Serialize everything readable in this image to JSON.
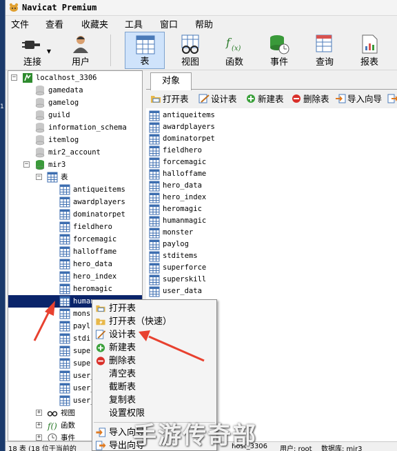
{
  "window": {
    "title": "Navicat Premium"
  },
  "menu": [
    "文件",
    "查看",
    "收藏夹",
    "工具",
    "窗口",
    "帮助"
  ],
  "toolbar": [
    {
      "label": "连接",
      "icon": "plug-icon"
    },
    {
      "label": "用户",
      "icon": "user-icon"
    },
    {
      "label": "表",
      "icon": "table-icon",
      "active": true
    },
    {
      "label": "视图",
      "icon": "view-icon"
    },
    {
      "label": "函数",
      "icon": "function-icon"
    },
    {
      "label": "事件",
      "icon": "event-icon"
    },
    {
      "label": "查询",
      "icon": "query-icon"
    },
    {
      "label": "报表",
      "icon": "report-icon"
    }
  ],
  "tree": {
    "connection": "localhost_3306",
    "databases": [
      "gamedata",
      "gamelog",
      "guild",
      "information_schema",
      "itemlog",
      "mir2_account",
      "mir3"
    ],
    "tables_folder": "表",
    "tables": [
      "antiqueitems",
      "awardplayers",
      "dominatorpet",
      "fieldhero",
      "forcemagic",
      "halloffame",
      "hero_data",
      "hero_index",
      "heromagic",
      "humanmagic",
      "monster",
      "paylog",
      "stditems",
      "superforce",
      "superskill",
      "user_data",
      "user_",
      "user_"
    ],
    "selected_table_visible": "human",
    "partial_rows": [
      "mons",
      "payl",
      "stdi",
      "supe",
      "supe"
    ],
    "folders": [
      {
        "label": "视图",
        "icon": "view-icon"
      },
      {
        "label": "函数",
        "icon": "function-icon"
      },
      {
        "label": "事件",
        "icon": "event-icon"
      }
    ]
  },
  "objects_tab": "对象",
  "object_toolbar": [
    {
      "label": "打开表",
      "icon": "open-table-icon"
    },
    {
      "label": "设计表",
      "icon": "design-table-icon"
    },
    {
      "label": "新建表",
      "icon": "new-table-icon"
    },
    {
      "label": "删除表",
      "icon": "delete-table-icon"
    },
    {
      "label": "导入向导",
      "icon": "import-wizard-icon"
    }
  ],
  "object_list": [
    "antiqueitems",
    "awardplayers",
    "dominatorpet",
    "fieldhero",
    "forcemagic",
    "halloffame",
    "hero_data",
    "hero_index",
    "heromagic",
    "humanmagic",
    "monster",
    "paylog",
    "stditems",
    "superforce",
    "superskill",
    "user_data"
  ],
  "context_menu": [
    {
      "label": "打开表",
      "icon": "open-table-icon"
    },
    {
      "label": "打开表（快速）",
      "icon": "open-table-fast-icon"
    },
    {
      "label": "设计表",
      "icon": "design-table-icon"
    },
    {
      "label": "新建表",
      "icon": "new-table-icon"
    },
    {
      "label": "删除表",
      "icon": "delete-table-icon"
    },
    {
      "label": "清空表",
      "icon": ""
    },
    {
      "label": "截断表",
      "icon": ""
    },
    {
      "label": "复制表",
      "icon": ""
    },
    {
      "label": "设置权限",
      "icon": ""
    },
    {
      "label": "导入向导",
      "icon": "import-wizard-icon"
    },
    {
      "label": "导出向导",
      "icon": "export-wizard-icon"
    }
  ],
  "status": {
    "left": "18 表 (18 位于当前的",
    "host": "host_3306",
    "user_label": "用户: root",
    "db_label": "数据库: mir3"
  },
  "watermark": "手游传奇部",
  "colors": {
    "selection": "#0a246a",
    "arrow": "#e8412f",
    "active_tool": "#cfe3fb"
  }
}
